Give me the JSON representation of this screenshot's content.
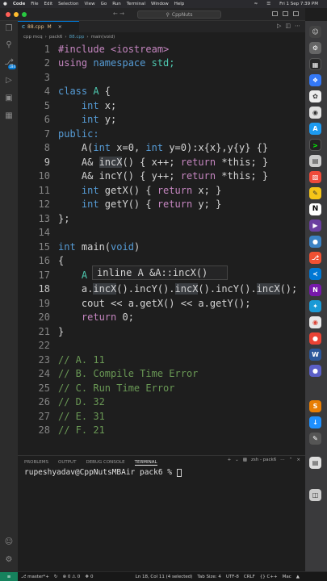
{
  "menubar": {
    "apple": "",
    "app": "Code",
    "items": [
      "File",
      "Edit",
      "Selection",
      "View",
      "Go",
      "Run",
      "Terminal",
      "Window",
      "Help"
    ],
    "clock": "Fri 1 Sep 7:39 PM"
  },
  "titlebar": {
    "search": "CppNuts"
  },
  "tab": {
    "filename": "88.cpp",
    "modified": "M",
    "lang_icon": "C"
  },
  "breadcrumb": [
    "cpp mcq",
    "pack6",
    "88.cpp",
    "main(void)"
  ],
  "code_lines": [
    {
      "num": "1"
    },
    {
      "num": "2"
    },
    {
      "num": "3"
    },
    {
      "num": "4"
    },
    {
      "num": "5"
    },
    {
      "num": "6"
    },
    {
      "num": "7"
    },
    {
      "num": "8"
    },
    {
      "num": "9"
    },
    {
      "num": "10"
    },
    {
      "num": "11"
    },
    {
      "num": "12"
    },
    {
      "num": "13"
    },
    {
      "num": "14"
    },
    {
      "num": "15"
    },
    {
      "num": "16"
    },
    {
      "num": "17"
    },
    {
      "num": "18"
    },
    {
      "num": "19"
    },
    {
      "num": "20"
    },
    {
      "num": "21"
    },
    {
      "num": "22"
    },
    {
      "num": "23"
    },
    {
      "num": "24"
    },
    {
      "num": "25"
    },
    {
      "num": "26"
    },
    {
      "num": "27"
    },
    {
      "num": "28"
    }
  ],
  "code": {
    "l1": "#include <iostream>",
    "l2a": "using",
    "l2b": " namespace",
    "l2c": " std;",
    "l4a": "class",
    "l4b": " A",
    "l4c": " {",
    "l5a": "    int",
    "l5b": " x;",
    "l6a": "    int",
    "l6b": " y;",
    "l7": "public:",
    "l8a": "    A(",
    "l8b": "int",
    "l8c": " x=0, ",
    "l8d": "int",
    "l8e": " y=0):x{x},y{y} {}",
    "l9a": "    A& ",
    "l9b": "incX",
    "l9c": "() { x++; ",
    "l9d": "return",
    "l9e": " *this; }",
    "l10a": "    A& incY() { y++; ",
    "l10b": "return",
    "l10c": " *this; }",
    "l11a": "    int",
    "l11b": " getX() { ",
    "l11c": "return",
    "l11d": " x; }",
    "l12a": "    int",
    "l12b": " getY() { ",
    "l12c": "return",
    "l12d": " y; }",
    "l13": "};",
    "l15a": "int",
    "l15b": " main(",
    "l15c": "void",
    "l15d": ")",
    "l16": "{",
    "l17": "    A",
    "l18a": "    a.",
    "l18b": "incX",
    "l18c": "().incY().",
    "l18d": "incX",
    "l18e": "().incY().",
    "l18f": "incX",
    "l18g": "();",
    "l19": "    cout << a.getX() << a.getY();",
    "l20a": "    ",
    "l20b": "return",
    "l20c": " 0;",
    "l21": "}",
    "l23": "// A. 11",
    "l24": "// B. Compile Time Error",
    "l25": "// C. Run Time Error",
    "l26": "// D. 32",
    "l27": "// E. 31",
    "l28": "// F. 21"
  },
  "tooltip": "inline A &A::incX()",
  "panel": {
    "tabs": [
      "PROBLEMS",
      "OUTPUT",
      "DEBUG CONSOLE",
      "TERMINAL"
    ],
    "shell": "zsh - pack6",
    "prompt": "rupeshyadav@CppNutsMBAir pack6 % "
  },
  "statusbar": {
    "branch": "master*+",
    "errors": "0",
    "warnings": "0",
    "ports": "0",
    "position": "Ln 18, Col 11 (4 selected)",
    "tab_size": "Tab Size: 4",
    "encoding": "UTF-8",
    "eol": "CRLF",
    "language": "{} C++",
    "platform": "Mac"
  },
  "activity_badge": "184"
}
